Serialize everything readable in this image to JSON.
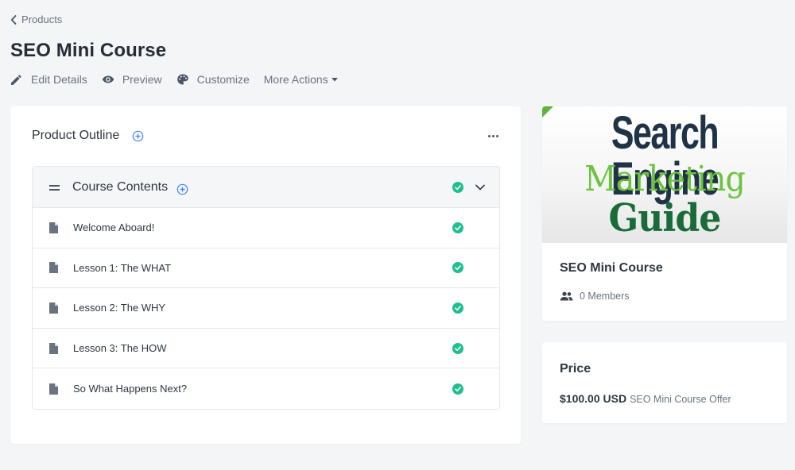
{
  "breadcrumb": {
    "label": "Products"
  },
  "page": {
    "title": "SEO Mini Course"
  },
  "actions": {
    "edit": {
      "label": "Edit Details",
      "icon": "pencil-icon"
    },
    "preview": {
      "label": "Preview",
      "icon": "eye-icon"
    },
    "customize": {
      "label": "Customize",
      "icon": "palette-icon"
    },
    "more": {
      "label": "More Actions",
      "icon": "caret-down-icon"
    }
  },
  "outline": {
    "title": "Product Outline",
    "section": {
      "title": "Course Contents",
      "lessons": [
        {
          "title": "Welcome Aboard!",
          "status": "published"
        },
        {
          "title": "Lesson 1: The WHAT",
          "status": "published"
        },
        {
          "title": "Lesson 2: The WHY",
          "status": "published"
        },
        {
          "title": "Lesson 3: The HOW",
          "status": "published"
        },
        {
          "title": "So What Happens Next?",
          "status": "published"
        }
      ]
    }
  },
  "product": {
    "image_text": {
      "line1": "Search Engine",
      "line2": "Marketing",
      "line3": "Guide"
    },
    "name": "SEO Mini Course",
    "members": "0 Members"
  },
  "price": {
    "title": "Price",
    "amount": "$100.00 USD",
    "offer": "SEO Mini Course Offer"
  },
  "colors": {
    "background": "#f4f5f7",
    "accent_blue": "#3b82f6",
    "success_green": "#1fbf8f",
    "text_dark": "#2f3640",
    "text_muted": "#6b7280"
  }
}
